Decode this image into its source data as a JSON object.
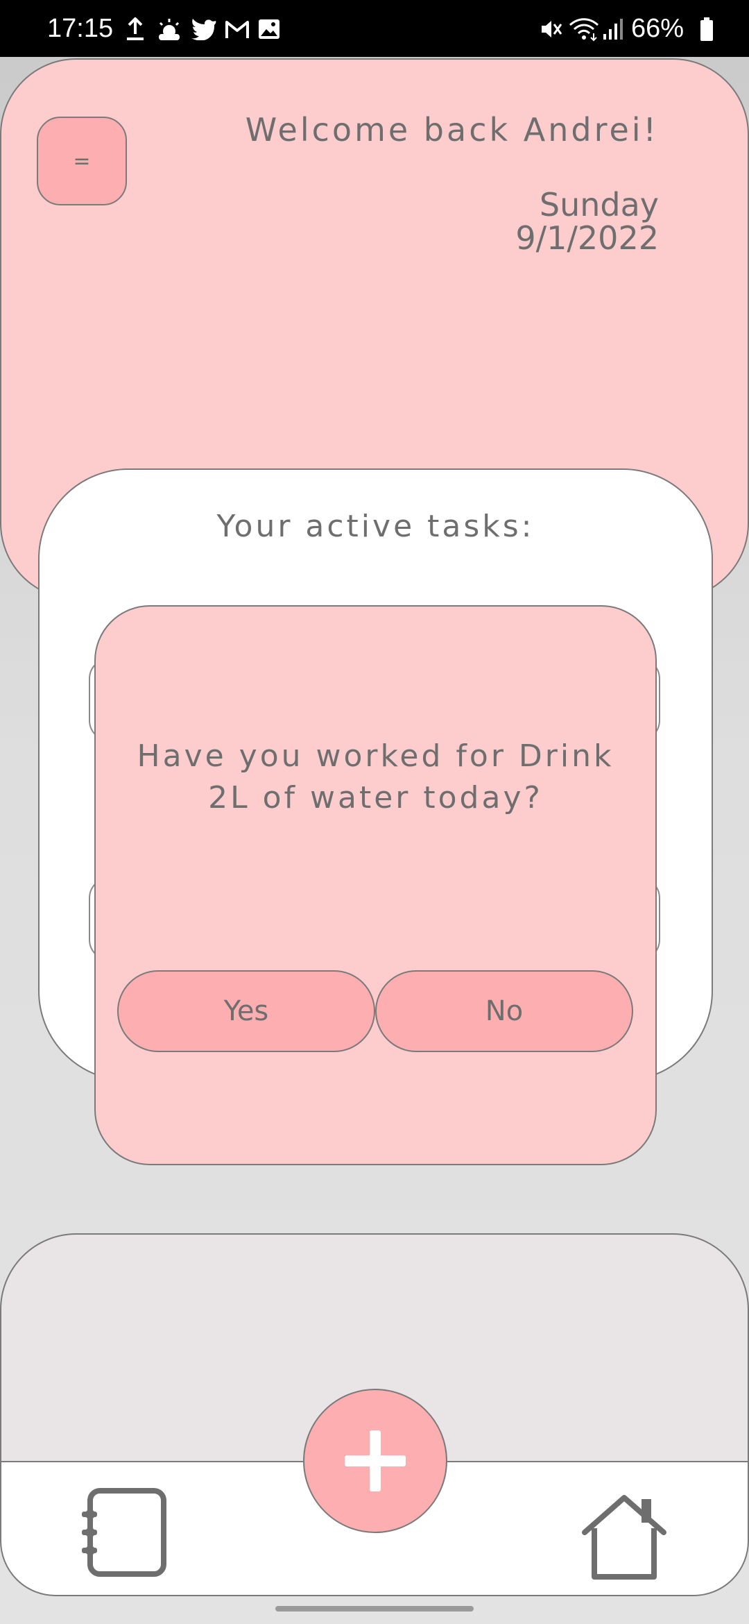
{
  "status_bar": {
    "time": "17:15",
    "battery": "66%",
    "icons": [
      "upload-icon",
      "weather-icon",
      "twitter-icon",
      "gmail-icon",
      "gallery-icon",
      "mute-icon",
      "wifi-icon",
      "signal-icon",
      "battery-icon"
    ]
  },
  "header": {
    "menu_label": "=",
    "welcome": "Welcome back Andrei!",
    "day": "Sunday",
    "date": "9/1/2022"
  },
  "tasks": {
    "title": "Your active tasks:"
  },
  "dialog": {
    "question": "Have you worked for Drink 2L of water today?",
    "yes_label": "Yes",
    "no_label": "No"
  },
  "nav": {
    "add_icon": "plus-icon",
    "left_icon": "notebook-icon",
    "right_icon": "home-icon"
  },
  "colors": {
    "card_pink": "#fdcdce",
    "button_pink": "#fdaeb0",
    "text_gray": "#6e6e6e",
    "panel_gray": "#e9e4e6"
  }
}
